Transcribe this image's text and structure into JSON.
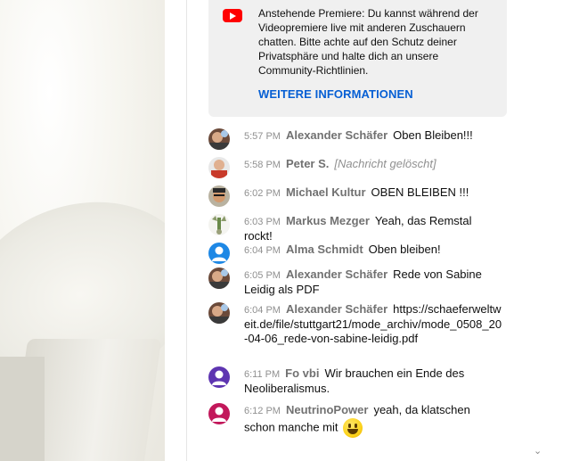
{
  "premiere": {
    "text": "Anstehende Premiere: Du kannst während der Videopremiere live mit anderen Zuschauern chatten. Bitte achte auf den Schutz deiner Privatsphäre und halte dich an unsere Community-Richtlinien.",
    "link": "WEITERE INFORMATIONEN"
  },
  "messages": [
    {
      "time": "5:57 PM",
      "author": "Alexander Schäfer",
      "text": "Oben Bleiben!!!",
      "avatar_color": "#6b4a3a"
    },
    {
      "time": "5:58 PM",
      "author": "Peter S.",
      "text": "[Nachricht gelöscht]",
      "avatar_color": "#c83a2a"
    },
    {
      "time": "6:02 PM",
      "author": "Michael Kultur",
      "text": "OBEN BLEIBEN !!!",
      "avatar_color": "#8a6a40"
    },
    {
      "time": "6:03 PM",
      "author": "Markus Mezger",
      "text": "Yeah, das Remstal rockt!",
      "avatar_color": "#cfd7c2"
    },
    {
      "time": "6:04 PM",
      "author": "Alma Schmidt",
      "text": "Oben bleiben!",
      "avatar_color": "#1e88e5"
    },
    {
      "time": "6:05 PM",
      "author": "Alexander Schäfer",
      "text": "Rede von Sabine Leidig als PDF",
      "avatar_color": "#6b4a3a"
    },
    {
      "time": "6:04 PM",
      "author": "Alexander Schäfer",
      "text": "https://schaeferweltweit.de/file/stuttgart21/mode_archiv/mode_0508_20-04-06_rede-von-sabine-leidig.pdf",
      "avatar_color": "#6b4a3a"
    },
    {
      "time": "6:11 PM",
      "author": "Fo vbi",
      "text": "Wir brauchen ein Ende des Neoliberalismus.",
      "avatar_color": "#5e35b1"
    },
    {
      "time": "6:12 PM",
      "author": "NeutrinoPower",
      "text": "yeah, da klatschen schon manche mit",
      "avatar_color": "#c2185b"
    }
  ],
  "icons": {
    "youtube": "youtube-icon",
    "emoji": "grinning-face-emoji",
    "scroll_down": "chevron-down-icon"
  }
}
